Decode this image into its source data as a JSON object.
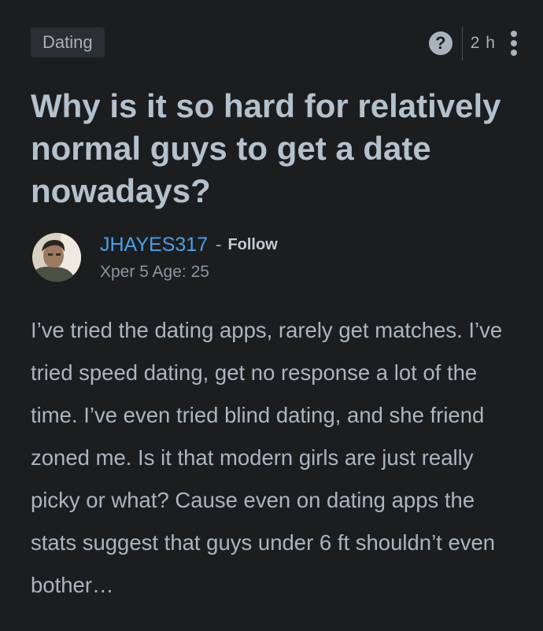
{
  "post": {
    "category": "Dating",
    "time_ago": "2 h",
    "title": "Why is it so hard for relatively normal guys to get a date nowadays?",
    "body": "I’ve tried the dating apps, rarely get matches. I’ve tried speed dating, get no response a lot of the time. I’ve even tried blind dating, and she friend zoned me. Is it that modern girls are just really picky or what? Cause even on dating apps the stats suggest that guys under 6 ft shouldn’t even bother…"
  },
  "author": {
    "username": "JHAYES317",
    "separator": "-",
    "follow_label": "Follow",
    "meta": "Xper 5 Age: 25"
  },
  "icons": {
    "help": "question-circle-icon",
    "more": "vertical-ellipsis-icon",
    "help_glyph": "?"
  },
  "colors": {
    "background": "#1b1d1f",
    "username": "#4a9fe9",
    "title": "#b3c1cd",
    "body_text": "#a9b5c0"
  }
}
